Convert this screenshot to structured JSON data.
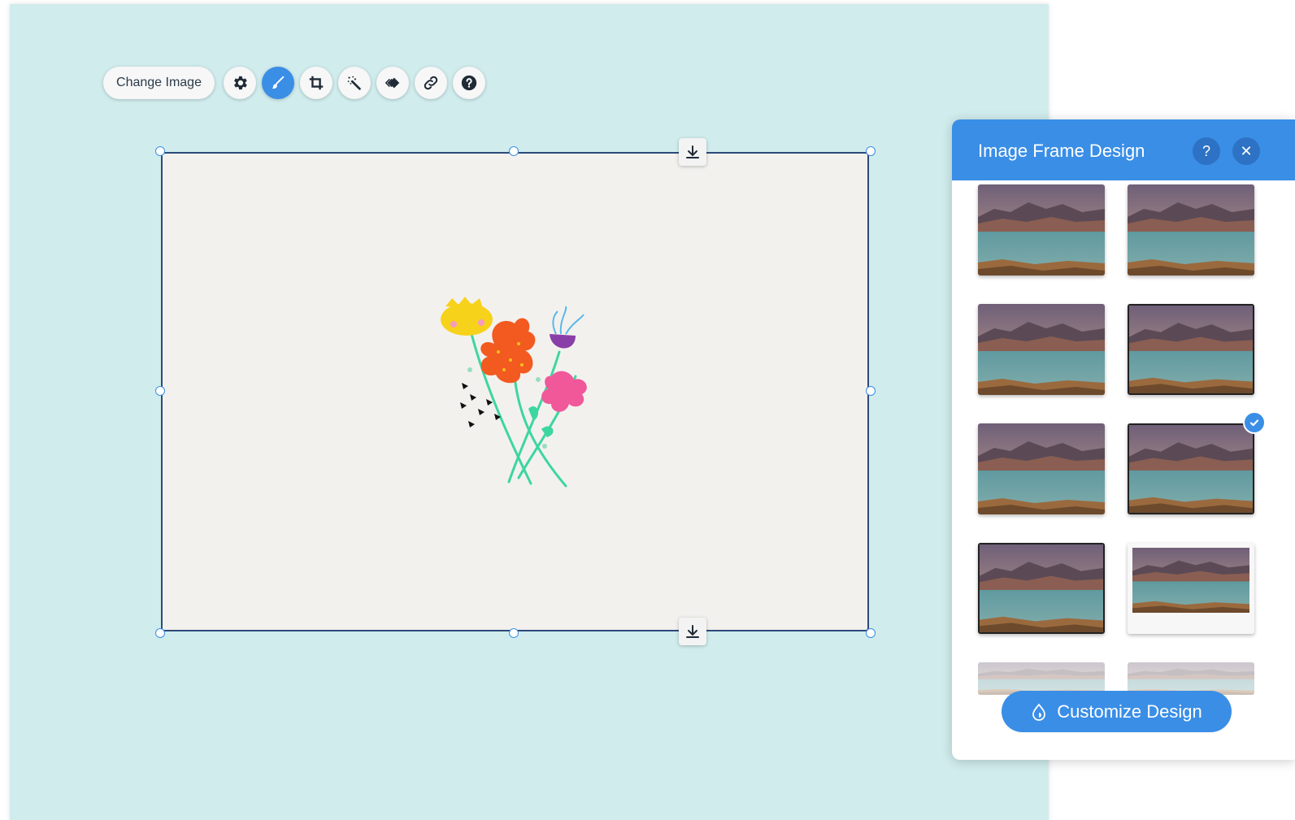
{
  "toolbar": {
    "change_image_label": "Change Image",
    "tools": [
      {
        "icon": "gear-icon",
        "active": false
      },
      {
        "icon": "brush-icon",
        "active": true
      },
      {
        "icon": "crop-icon",
        "active": false
      },
      {
        "icon": "magic-wand-icon",
        "active": false
      },
      {
        "icon": "animation-icon",
        "active": false
      },
      {
        "icon": "link-icon",
        "active": false
      },
      {
        "icon": "help-icon",
        "active": false
      }
    ]
  },
  "panel": {
    "title": "Image Frame Design",
    "help_label": "?",
    "close_label": "✕",
    "selected_index": 5,
    "customize_label": "Customize Design"
  },
  "colors": {
    "accent": "#3a8ee6",
    "canvas_bg": "#d0eced",
    "frame_bg": "#f3f1ee"
  }
}
